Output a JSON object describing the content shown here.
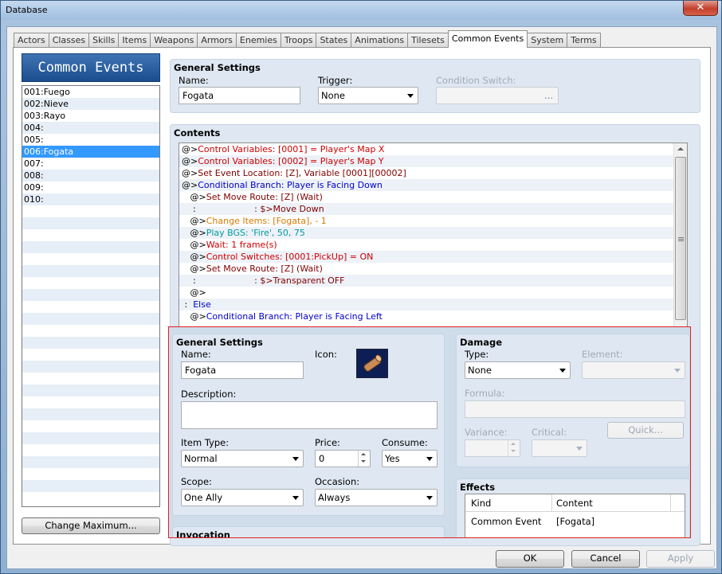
{
  "window": {
    "title": "Database",
    "close_label": "✕"
  },
  "tabs": [
    "Actors",
    "Classes",
    "Skills",
    "Items",
    "Weapons",
    "Armors",
    "Enemies",
    "Troops",
    "States",
    "Animations",
    "Tilesets",
    "Common Events",
    "System",
    "Terms"
  ],
  "sidebar": {
    "header": "Common Events",
    "items": [
      "001:Fuego",
      "002:Nieve",
      "003:Rayo",
      "004:",
      "005:",
      "006:Fogata",
      "007:",
      "008:",
      "009:",
      "010:"
    ],
    "selected_index": 5,
    "change_max_label": "Change Maximum..."
  },
  "general": {
    "title": "General Settings",
    "name_label": "Name:",
    "name_value": "Fogata",
    "trigger_label": "Trigger:",
    "trigger_value": "None",
    "condition_switch_label": "Condition Switch:",
    "condition_switch_button": "..."
  },
  "contents": {
    "title": "Contents",
    "lines": [
      {
        "prefix": "@>",
        "text": "Control Variables: [0001] = Player's Map X",
        "color": "#cc0000"
      },
      {
        "prefix": "@>",
        "text": "Control Variables: [0002] = Player's Map Y",
        "color": "#cc0000"
      },
      {
        "prefix": "@>",
        "text": "Set Event Location: [Z], Variable [0001][00002]",
        "color": "#800000"
      },
      {
        "prefix": "@>",
        "text": "Conditional Branch: Player is Facing Down",
        "color": "#0000cc"
      },
      {
        "prefix": "   @>",
        "text": "Set Move Route: [Z] (Wait)",
        "color": "#800000"
      },
      {
        "prefix": "    :",
        "text": "                     : $>Move Down",
        "color": "#800000"
      },
      {
        "prefix": "   @>",
        "text": "Change Items: [Fogata], - 1",
        "color": "#d97a00"
      },
      {
        "prefix": "   @>",
        "text": "Play BGS: 'Fire', 50, 75",
        "color": "#009999"
      },
      {
        "prefix": "   @>",
        "text": "Wait: 1 frame(s)",
        "color": "#cc0000"
      },
      {
        "prefix": "   @>",
        "text": "Control Switches: [0001:PickUp] = ON",
        "color": "#cc0000"
      },
      {
        "prefix": "   @>",
        "text": "Set Move Route: [Z] (Wait)",
        "color": "#800000"
      },
      {
        "prefix": "    :",
        "text": "                     : $>Transparent OFF",
        "color": "#800000"
      },
      {
        "prefix": "   @>",
        "text": "",
        "color": "#000000"
      },
      {
        "prefix": " :  ",
        "text": "Else",
        "color": "#0000cc"
      },
      {
        "prefix": "   @>",
        "text": "Conditional Branch: Player is Facing Left",
        "color": "#0000cc"
      }
    ]
  },
  "item_panel": {
    "general_title": "General Settings",
    "name_label": "Name:",
    "name_value": "Fogata",
    "icon_label": "Icon:",
    "description_label": "Description:",
    "description_value": "",
    "item_type_label": "Item Type:",
    "item_type_value": "Normal",
    "price_label": "Price:",
    "price_value": "0",
    "consume_label": "Consume:",
    "consume_value": "Yes",
    "scope_label": "Scope:",
    "scope_value": "One Ally",
    "occasion_label": "Occasion:",
    "occasion_value": "Always",
    "invocation_title": "Invocation",
    "damage_title": "Damage",
    "type_label": "Type:",
    "type_value": "None",
    "element_label": "Element:",
    "formula_label": "Formula:",
    "variance_label": "Variance:",
    "critical_label": "Critical:",
    "quick_label": "Quick...",
    "effects_title": "Effects",
    "effects_columns": [
      "Kind",
      "Content"
    ],
    "effects_rows": [
      {
        "kind": "Common Event",
        "content": "[Fogata]"
      }
    ]
  },
  "footer": {
    "ok": "OK",
    "cancel": "Cancel",
    "apply": "Apply"
  },
  "colors": {
    "selection": "#3399ff",
    "header_blue": "#1a4d8d",
    "highlight_frame": "#e02020"
  }
}
